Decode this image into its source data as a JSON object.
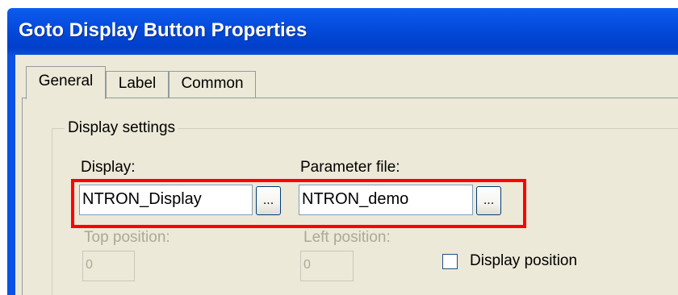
{
  "window": {
    "title": "Goto Display Button Properties"
  },
  "tabs": [
    {
      "label": "General",
      "active": true
    },
    {
      "label": "Label",
      "active": false
    },
    {
      "label": "Common",
      "active": false
    }
  ],
  "display_settings": {
    "group_label": "Display settings",
    "display": {
      "label": "Display:",
      "value": "NTRON_Display",
      "browse_label": "..."
    },
    "parameter_file": {
      "label": "Parameter file:",
      "value": "NTRON_demo",
      "browse_label": "..."
    },
    "top_position": {
      "label": "Top position:",
      "value": "0",
      "enabled": false
    },
    "left_position": {
      "label": "Left position:",
      "value": "0",
      "enabled": false
    },
    "display_position": {
      "label": "Display position",
      "checked": false
    }
  },
  "annotation": {
    "highlight_color": "#ff0000"
  },
  "colors": {
    "titlebar": "#0a55e8",
    "dialog_bg": "#ece9d8",
    "title_text": "#ffffff"
  }
}
